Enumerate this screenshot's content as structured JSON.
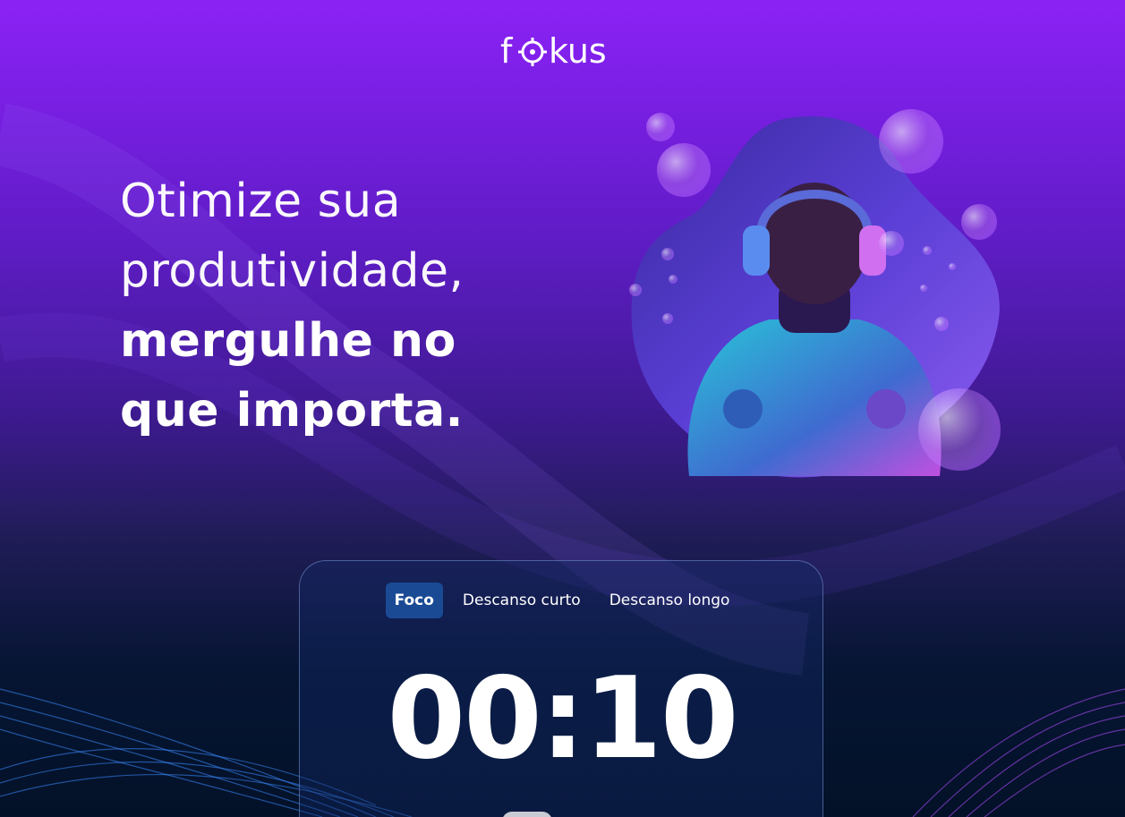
{
  "brand": {
    "logo_pre": "f",
    "logo_post": "kus"
  },
  "hero": {
    "line1": "Otimize sua",
    "line2": "produtividade,",
    "line3": "mergulhe no",
    "line4": "que importa."
  },
  "timer_card": {
    "tabs": [
      {
        "label": "Foco",
        "active": true
      },
      {
        "label": "Descanso curto",
        "active": false
      },
      {
        "label": "Descanso longo",
        "active": false
      }
    ],
    "time": "00:10"
  },
  "colors": {
    "accent_tab": "#1a4a94",
    "bg_top": "#8b22f5",
    "bg_bottom": "#031128"
  },
  "icons": {
    "logo_o": "target-icon"
  }
}
